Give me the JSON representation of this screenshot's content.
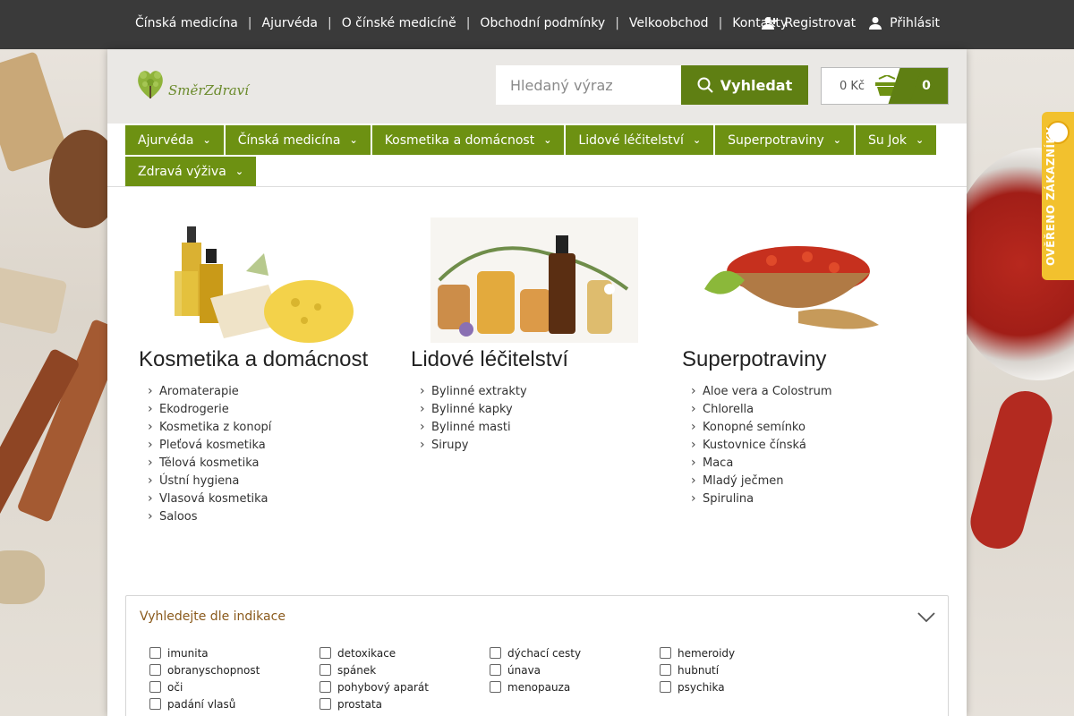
{
  "topbar": {
    "links": [
      "Čínská medicína",
      "Ajurvéda",
      "O čínské medicíně",
      "Obchodní podmínky",
      "Velkoobchod",
      "Kontakty"
    ],
    "register": "Registrovat",
    "login": "Přihlásit"
  },
  "header": {
    "logo_text": "SměrZdraví",
    "search_placeholder": "Hledaný výraz",
    "search_button": "Vyhledat",
    "cart_price": "0 Kč",
    "cart_count": "0"
  },
  "categories": [
    "Ajurvéda",
    "Čínská medicína",
    "Kosmetika a domácnost",
    "Lidové léčitelství",
    "Superpotraviny",
    "Su Jok",
    "Zdravá výživa"
  ],
  "sections": [
    {
      "title": "Kosmetika a domácnost",
      "items": [
        "Aromaterapie",
        "Ekodrogerie",
        "Kosmetika z konopí",
        "Pleťová kosmetika",
        "Tělová kosmetika",
        "Ústní hygiena",
        "Vlasová kosmetika",
        "Saloos"
      ]
    },
    {
      "title": "Lidové léčitelství",
      "items": [
        "Bylinné extrakty",
        "Bylinné kapky",
        "Bylinné masti",
        "Sirupy"
      ]
    },
    {
      "title": "Superpotraviny",
      "items": [
        "Aloe vera a Colostrum",
        "Chlorella",
        "Konopné semínko",
        "Kustovnice čínská",
        "Maca",
        "Mladý ječmen",
        "Spirulina"
      ]
    }
  ],
  "indikace": {
    "title": "Vyhledejte dle indikace",
    "columns": [
      [
        "imunita",
        "obranyschopnost",
        "oči",
        "padání vlasů"
      ],
      [
        "detoxikace",
        "spánek",
        "pohybový aparát",
        "prostata"
      ],
      [
        "dýchací cesty",
        "únava",
        "menopauza"
      ],
      [
        "hemeroidy",
        "hubnutí",
        "psychika"
      ]
    ]
  },
  "badge": {
    "text": "OVĚŘENO ZÁKAZNÍKY"
  },
  "colors": {
    "topbar": "#3a3a3a",
    "green": "#6d9112",
    "green_dark": "#5f7f13",
    "badge": "#f2c12e"
  }
}
